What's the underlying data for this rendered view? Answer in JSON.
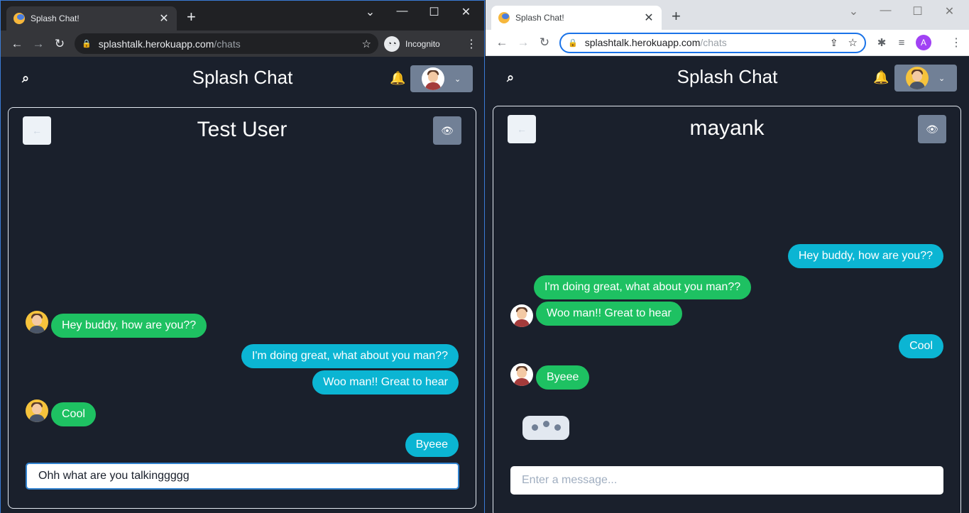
{
  "left": {
    "tab_title": "Splash Chat!",
    "tab_close": "✕",
    "newtab": "+",
    "wc_min": "⌄",
    "wc_minimize": "—",
    "wc_max": "☐",
    "wc_close": "✕",
    "url_host": "splashtalk.herokuapp.com",
    "url_path": "/chats",
    "incognito_label": "Incognito",
    "brand": "Splash Chat",
    "chat_name": "Test User",
    "messages": [
      {
        "text": "Hey buddy, how are you??",
        "side": "left",
        "color": "green"
      },
      {
        "text": "I'm doing great, what about you man??",
        "side": "right",
        "color": "blue"
      },
      {
        "text": "Woo man!! Great to hear",
        "side": "right",
        "color": "blue"
      },
      {
        "text": "Cool",
        "side": "left",
        "color": "green"
      },
      {
        "text": "Byeee",
        "side": "right",
        "color": "blue"
      }
    ],
    "composer_value": "Ohh what are you talkinggggg"
  },
  "right": {
    "tab_title": "Splash Chat!",
    "tab_close": "✕",
    "newtab": "+",
    "url_host": "splashtalk.herokuapp.com",
    "url_path": "/chats",
    "profile_initial": "A",
    "brand": "Splash Chat",
    "chat_name": "mayank",
    "messages": [
      {
        "text": "Hey buddy, how are you??",
        "side": "right",
        "color": "blue"
      },
      {
        "text": "I'm doing great, what about you man??",
        "side": "left",
        "color": "green"
      },
      {
        "text": "Woo man!! Great to hear",
        "side": "left",
        "color": "green"
      },
      {
        "text": "Cool",
        "side": "right",
        "color": "blue"
      },
      {
        "text": "Byeee",
        "side": "left",
        "color": "green"
      }
    ],
    "composer_placeholder": "Enter a message..."
  },
  "icons": {
    "back": "←",
    "eye": "👁",
    "search": "⌕",
    "bell": "🔔",
    "chevron": "⌄",
    "reload": "↻",
    "nav_back": "←",
    "nav_forward": "→",
    "lock": "🔒",
    "star": "☆",
    "menu": "⋮",
    "puzzle": "✱",
    "media": "≡",
    "share": "⇪",
    "incognito": "◔◔"
  },
  "colors": {
    "app_bg": "#1a202c",
    "bubble_green": "#1ec162",
    "bubble_blue": "#0bb5d3",
    "button_gray": "#718096"
  }
}
